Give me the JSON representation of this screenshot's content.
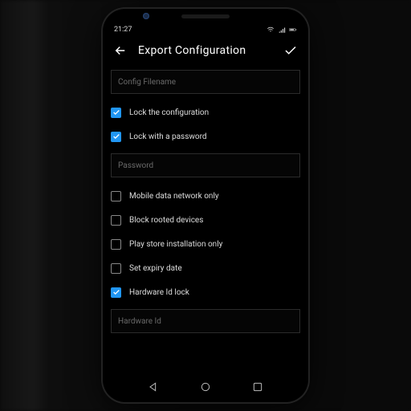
{
  "status": {
    "time": "21:27"
  },
  "appbar": {
    "title": "Export Configuration"
  },
  "fields": {
    "config_filename": "Config Filename",
    "password": "Password",
    "hardware_id": "Hardware Id"
  },
  "options": {
    "lock_config": {
      "label": "Lock the configuration",
      "checked": true
    },
    "lock_password": {
      "label": "Lock with a password",
      "checked": true
    },
    "mobile_data": {
      "label": "Mobile data network only",
      "checked": false
    },
    "block_rooted": {
      "label": "Block rooted devices",
      "checked": false
    },
    "play_store": {
      "label": "Play store installation only",
      "checked": false
    },
    "expiry": {
      "label": "Set expiry date",
      "checked": false
    },
    "hwid_lock": {
      "label": "Hardware Id lock",
      "checked": true
    }
  },
  "colors": {
    "accent": "#2196f3"
  }
}
